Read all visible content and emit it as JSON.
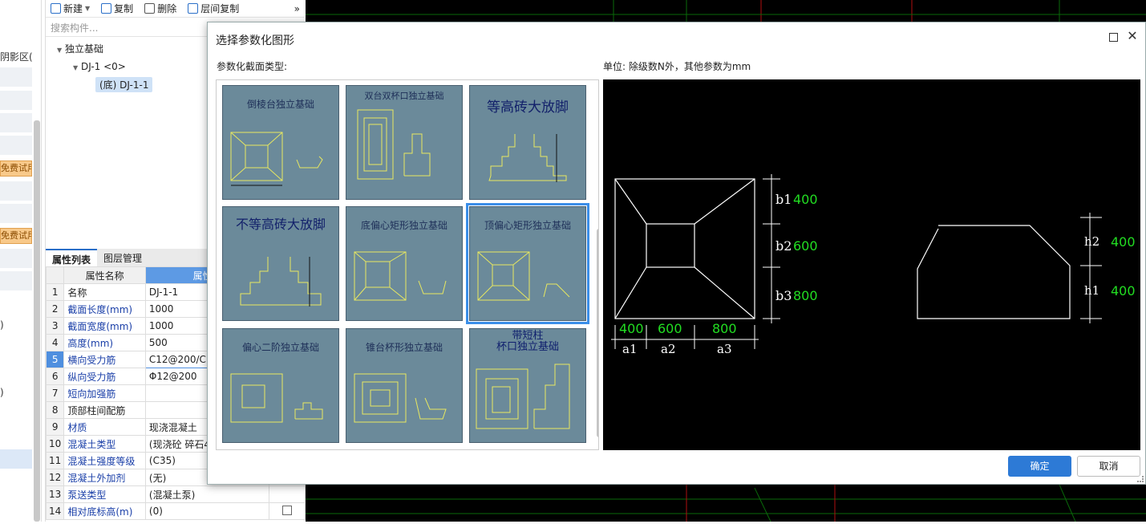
{
  "left_strip": {
    "partial_text": "阴影区(",
    "trial_badges": [
      "免费试用",
      "免费试用"
    ],
    "side_chars": [
      ")",
      ")"
    ]
  },
  "toolbar": {
    "new_label": "新建",
    "copy_label": "复制",
    "delete_label": "删除",
    "floor_copy_label": "层间复制",
    "more_glyph": "»"
  },
  "search": {
    "placeholder": "搜索构件..."
  },
  "tree": {
    "root": "独立基础",
    "child": "DJ-1 <0>",
    "leaf": "(底) DJ-1-1"
  },
  "prop_tabs": [
    "属性列表",
    "图层管理"
  ],
  "prop_table": {
    "headers": [
      "属性名称",
      "属性值"
    ],
    "rows": [
      {
        "n": "1",
        "name": "名称",
        "value": "DJ-1-1"
      },
      {
        "n": "2",
        "name": "截面长度(mm)",
        "value": "1000"
      },
      {
        "n": "3",
        "name": "截面宽度(mm)",
        "value": "1000"
      },
      {
        "n": "4",
        "name": "高度(mm)",
        "value": "500"
      },
      {
        "n": "5",
        "name": "横向受力筋",
        "value": "C12@200/C"
      },
      {
        "n": "6",
        "name": "纵向受力筋",
        "value": "Φ12@200"
      },
      {
        "n": "7",
        "name": "短向加强筋",
        "value": ""
      },
      {
        "n": "8",
        "name": "顶部柱间配筋",
        "value": ""
      },
      {
        "n": "9",
        "name": "材质",
        "value": "现浇混凝土"
      },
      {
        "n": "10",
        "name": "混凝土类型",
        "value": "(现浇砼 碎石4"
      },
      {
        "n": "11",
        "name": "混凝土强度等级",
        "value": "(C35)"
      },
      {
        "n": "12",
        "name": "混凝土外加剂",
        "value": "(无)"
      },
      {
        "n": "13",
        "name": "泵送类型",
        "value": "(混凝土泵)"
      },
      {
        "n": "14",
        "name": "相对底标高(m)",
        "value": "(0)"
      }
    ]
  },
  "dialog": {
    "title": "选择参数化图形",
    "type_label": "参数化截面类型:",
    "unit_label": "单位:    除级数N外，其他参数为mm",
    "ok": "确定",
    "cancel": "取消",
    "shapes": [
      {
        "title": "倒棱台独立基础"
      },
      {
        "title": "双台双杯口独立基础"
      },
      {
        "title": "等高砖大放脚"
      },
      {
        "title": "不等高砖大放脚"
      },
      {
        "title": "底偏心矩形独立基础"
      },
      {
        "title": "顶偏心矩形独立基础"
      },
      {
        "title": "偏心二阶独立基础"
      },
      {
        "title": "锥台杯形独立基础"
      },
      {
        "title": "带短柱\n杯口独立基础"
      }
    ],
    "preview": {
      "b1": "b1",
      "b1_val": "400",
      "b2": "b2",
      "b2_val": "600",
      "b3": "b3",
      "b3_val": "800",
      "a1_val": "400",
      "a2_val": "600",
      "a3_val": "800",
      "a1": "a1",
      "a2": "a2",
      "a3": "a3",
      "h2": "h2",
      "h2_val": "400",
      "h1": "h1",
      "h1_val": "400"
    },
    "colors": {
      "accent": "#2d7ad6",
      "value_green": "#22dd22"
    }
  }
}
